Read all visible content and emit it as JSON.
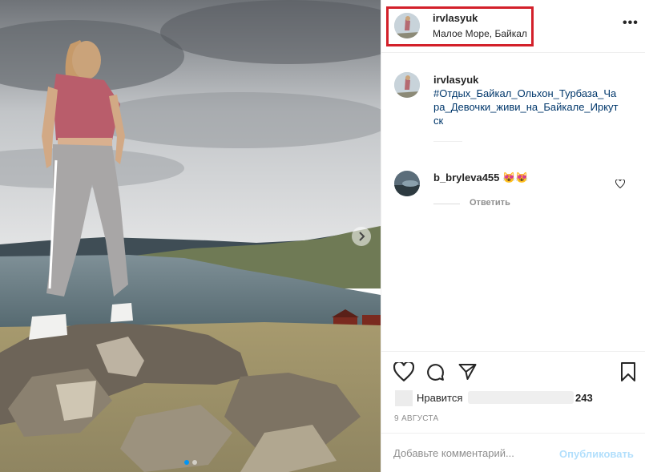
{
  "post": {
    "username": "irvlasyuk",
    "location": "Малое Море, Байкал",
    "more_icon": "more-horizontal-icon"
  },
  "caption": {
    "username": "irvlasyuk",
    "text": "#Отдых_Байкал_Ольхон_Турбаза_Чара_Девочки_живи_на_Байкале_Иркутск"
  },
  "comments": [
    {
      "username": "b_bryleva455",
      "text": "😻😻",
      "reply_label": "Ответить"
    }
  ],
  "likes": {
    "label": "Нравится",
    "count": "243"
  },
  "date": "9 АВГУСТА",
  "add_comment": {
    "placeholder": "Добавьте комментарий...",
    "publish_label": "Опубликовать"
  },
  "colors": {
    "highlight": "#d3202a",
    "link": "#00376b",
    "publish_disabled": "#b2dffc",
    "carousel_active": "#0095f6"
  }
}
